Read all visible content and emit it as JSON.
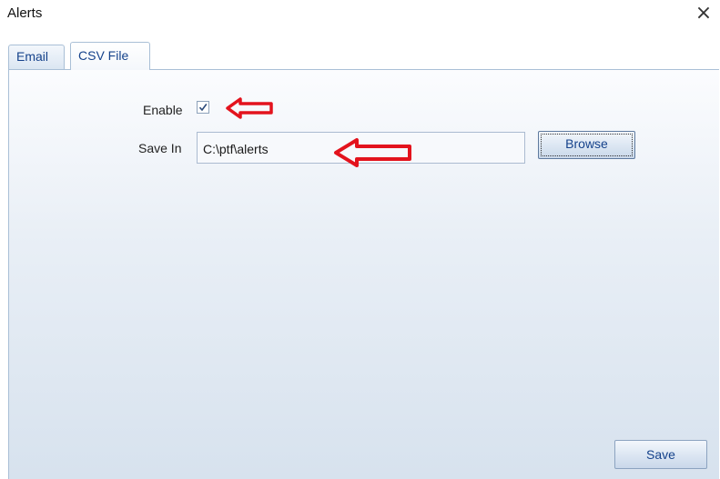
{
  "window": {
    "title": "Alerts",
    "close_icon": "close-icon"
  },
  "tabs": [
    {
      "label": "Email",
      "selected": false
    },
    {
      "label": "CSV File",
      "selected": true
    }
  ],
  "form": {
    "enable_label": "Enable",
    "enable_checked": true,
    "save_in_label": "Save In",
    "save_in_value": "C:\\ptf\\alerts",
    "browse_label": "Browse"
  },
  "footer": {
    "save_label": "Save"
  },
  "annotations": {
    "arrow_color": "#e3131d",
    "arrow_icon": "red-arrow-left-icon"
  }
}
